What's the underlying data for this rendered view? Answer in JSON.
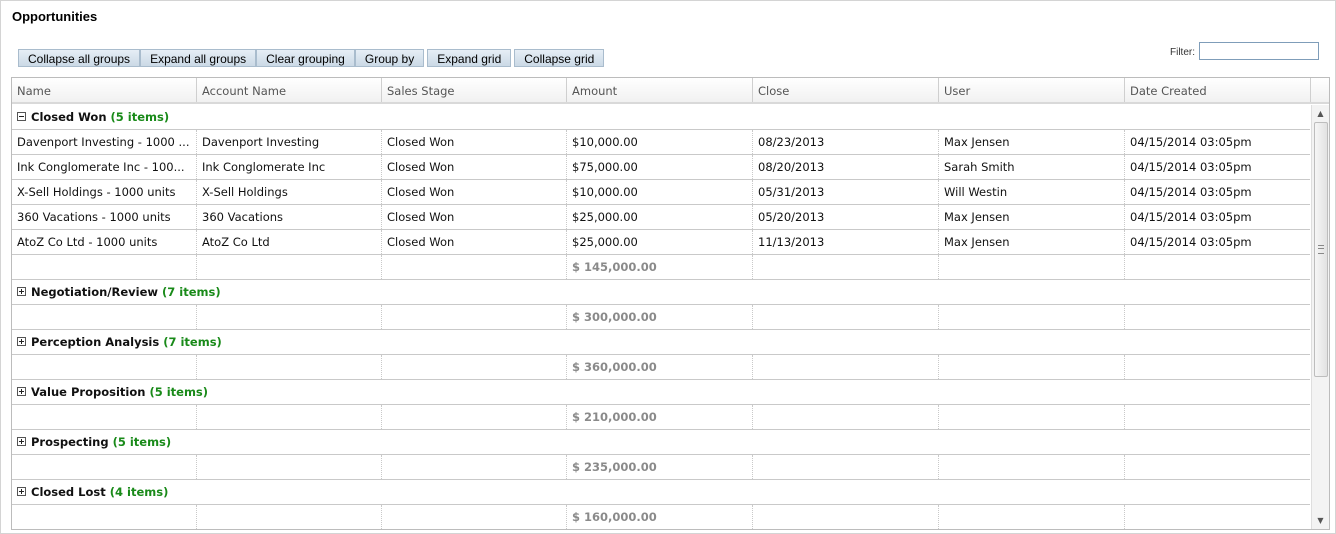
{
  "page": {
    "title": "Opportunities"
  },
  "toolbar": {
    "buttons": [
      {
        "label": "Collapse all groups"
      },
      {
        "label": "Expand all groups"
      },
      {
        "label": "Clear grouping"
      },
      {
        "label": "Group by"
      },
      {
        "label": "Expand grid"
      },
      {
        "label": "Collapse grid"
      }
    ]
  },
  "filter": {
    "label": "Filter:",
    "value": "",
    "placeholder": ""
  },
  "grid": {
    "columns": [
      "Name",
      "Account Name",
      "Sales Stage",
      "Amount",
      "Close",
      "User",
      "Date Created"
    ],
    "groups": [
      {
        "title": "Closed Won",
        "count": "(5 items)",
        "expanded": true,
        "rows": [
          [
            "Davenport Investing - 1000 ...",
            "Davenport Investing",
            "Closed Won",
            "$10,000.00",
            "08/23/2013",
            "Max Jensen",
            "04/15/2014 03:05pm"
          ],
          [
            "Ink Conglomerate Inc - 100...",
            "Ink Conglomerate Inc",
            "Closed Won",
            "$75,000.00",
            "08/20/2013",
            "Sarah Smith",
            "04/15/2014 03:05pm"
          ],
          [
            "X-Sell Holdings - 1000 units",
            "X-Sell Holdings",
            "Closed Won",
            "$10,000.00",
            "05/31/2013",
            "Will Westin",
            "04/15/2014 03:05pm"
          ],
          [
            "360 Vacations - 1000 units",
            "360 Vacations",
            "Closed Won",
            "$25,000.00",
            "05/20/2013",
            "Max Jensen",
            "04/15/2014 03:05pm"
          ],
          [
            "AtoZ Co Ltd - 1000 units",
            "AtoZ Co Ltd",
            "Closed Won",
            "$25,000.00",
            "11/13/2013",
            "Max Jensen",
            "04/15/2014 03:05pm"
          ]
        ],
        "total": "$ 145,000.00"
      },
      {
        "title": "Negotiation/Review",
        "count": "(7 items)",
        "expanded": false,
        "rows": [],
        "total": "$ 300,000.00"
      },
      {
        "title": "Perception Analysis",
        "count": "(7 items)",
        "expanded": false,
        "rows": [],
        "total": "$ 360,000.00"
      },
      {
        "title": "Value Proposition",
        "count": "(5 items)",
        "expanded": false,
        "rows": [],
        "total": "$ 210,000.00"
      },
      {
        "title": "Prospecting",
        "count": "(5 items)",
        "expanded": false,
        "rows": [],
        "total": "$ 235,000.00"
      },
      {
        "title": "Closed Lost",
        "count": "(4 items)",
        "expanded": false,
        "rows": [],
        "total": "$ 160,000.00"
      }
    ]
  },
  "icons": {
    "expand": "plus-box-icon",
    "collapse": "minus-box-icon",
    "scroll_up": "arrow-up-icon",
    "scroll_down": "arrow-down-icon"
  },
  "colors": {
    "group_count": "#198a19",
    "total_text": "#8a8a8a",
    "button_bg": "#cbd9e6"
  }
}
